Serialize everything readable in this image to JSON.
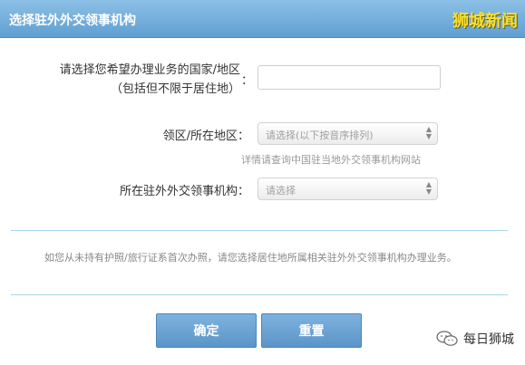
{
  "header": {
    "title": "选择驻外外交领事机构",
    "brand": "狮城新闻"
  },
  "form": {
    "country_label_line1": "请选择您希望办理业务的国家/地区",
    "country_label_line2": "（包括但不限于居住地）",
    "colon": "：",
    "country_value": "",
    "district_label": "领区/所在地区：",
    "district_selected": "请选择(以下按音序排列)",
    "hint": "详情请查询中国驻当地外交领事机构网站",
    "consulate_label": "所在驻外外交领事机构：",
    "consulate_selected": "请选择"
  },
  "notice": "如您从未持有护照/旅行证系首次办照，请您选择居住地所属相关驻外外交领事机构办理业务。",
  "buttons": {
    "confirm": "确定",
    "reset": "重置"
  },
  "watermark": {
    "account_name": "每日狮城",
    "icon": "wechat-icon"
  },
  "colors": {
    "header_bg": "#6aa8d8",
    "brand": "#f8e033",
    "button_bg": "#6aa3d4",
    "divider": "#a9d3e9"
  }
}
